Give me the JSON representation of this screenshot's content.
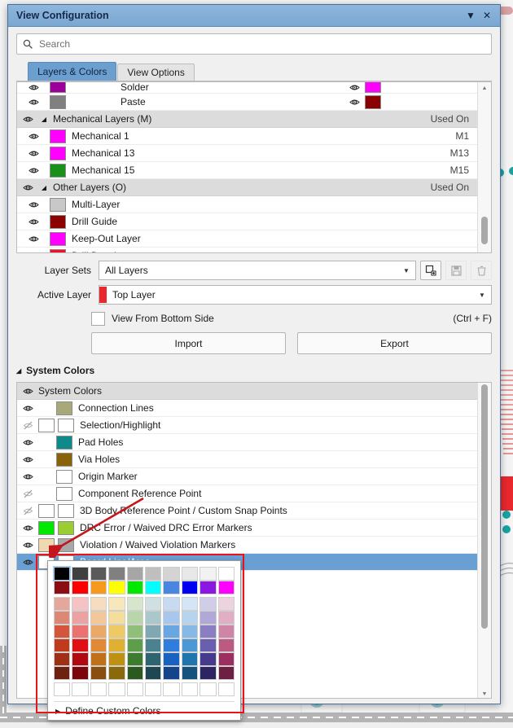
{
  "window": {
    "title": "View Configuration",
    "collapse_icon": "chevron-down-icon",
    "close_icon": "close-icon"
  },
  "search": {
    "placeholder": "Search",
    "value": "",
    "icon": "search-icon"
  },
  "tabs": [
    {
      "label": "Layers & Colors",
      "active": true
    },
    {
      "label": "View Options",
      "active": false
    }
  ],
  "layer_tree": {
    "used_on_header": "Used On",
    "rows": [
      {
        "label": "Solder",
        "used_on": "",
        "color": "#9b009b",
        "color2": "#ff00ff",
        "indent": 1,
        "type": "dual",
        "visible": true,
        "clipped": true
      },
      {
        "label": "Paste",
        "used_on": "",
        "color": "#808080",
        "color2": "#8b0000",
        "indent": 1,
        "type": "dual",
        "visible": true
      },
      {
        "label": "Mechanical Layers (M)",
        "used_on": "Used On",
        "indent": 0,
        "type": "group",
        "visible": true
      },
      {
        "label": "Mechanical 1",
        "used_on": "M1",
        "color": "#ff00ff",
        "indent": 1,
        "type": "layer",
        "visible": true
      },
      {
        "label": "Mechanical 13",
        "used_on": "M13",
        "color": "#ff00ff",
        "indent": 1,
        "type": "layer",
        "visible": true
      },
      {
        "label": "Mechanical 15",
        "used_on": "M15",
        "color": "#1a8f1a",
        "indent": 1,
        "type": "layer",
        "visible": true
      },
      {
        "label": "Other Layers (O)",
        "used_on": "Used On",
        "indent": 0,
        "type": "group",
        "visible": true
      },
      {
        "label": "Multi-Layer",
        "used_on": "",
        "color": "#c8c8c8",
        "indent": 1,
        "type": "layer",
        "visible": true
      },
      {
        "label": "Drill Guide",
        "used_on": "",
        "color": "#8b0000",
        "indent": 1,
        "type": "layer",
        "visible": true
      },
      {
        "label": "Keep-Out Layer",
        "used_on": "",
        "color": "#ff00ff",
        "indent": 1,
        "type": "layer",
        "visible": true
      },
      {
        "label": "Drill Drawing",
        "used_on": "",
        "color": "#f01028",
        "indent": 1,
        "type": "layer",
        "visible": true
      }
    ]
  },
  "controls": {
    "layer_sets_label": "Layer Sets",
    "layer_sets_value": "All Layers",
    "add_layer_set_icon": "add-layer-set-icon",
    "save_layer_set_icon": "save-icon",
    "delete_layer_set_icon": "trash-icon",
    "active_layer_label": "Active Layer",
    "active_layer_value": "Top Layer",
    "active_layer_color": "#e8282d",
    "view_from_bottom_label": "View From Bottom Side",
    "view_from_bottom_checked": false,
    "view_from_bottom_shortcut": "(Ctrl + F)",
    "import_label": "Import",
    "export_label": "Export"
  },
  "system_colors": {
    "section_title": "System Colors",
    "header_label": "System Colors",
    "rows": [
      {
        "label": "Connection Lines",
        "color": "#a8a878",
        "color2": "",
        "visible": true,
        "selected": false
      },
      {
        "label": "Selection/Highlight",
        "color": "#ffffff",
        "color2": "#ffffff",
        "visible": false,
        "selected": false
      },
      {
        "label": "Pad Holes",
        "color": "#0f8a8a",
        "color2": "",
        "visible": true,
        "selected": false
      },
      {
        "label": "Via Holes",
        "color": "#8a6208",
        "color2": "",
        "visible": true,
        "selected": false
      },
      {
        "label": "Origin Marker",
        "color": "#ffffff",
        "color2": "",
        "visible": true,
        "selected": false
      },
      {
        "label": "Component Reference Point",
        "color": "#ffffff",
        "color2": "",
        "visible": false,
        "hidden_eye": true,
        "selected": false
      },
      {
        "label": "3D Body Reference Point / Custom Snap Points",
        "color": "#ffffff",
        "color2": "#ffffff",
        "visible": false,
        "hidden_eye": true,
        "selected": false
      },
      {
        "label": "DRC Error / Waived DRC Error Markers",
        "color": "#00e800",
        "color2": "#9acd32",
        "visible": true,
        "selected": false
      },
      {
        "label": "Violation / Waived Violation Markers",
        "color": "#f0d8b0",
        "color2": "#a8a8a8",
        "visible": true,
        "selected": false
      },
      {
        "label": "Board Line/Area",
        "color": "#ffffff",
        "color2": "#ffffff",
        "visible": true,
        "selected": true
      }
    ]
  },
  "color_picker": {
    "define_custom_label": "Define Custom Colors",
    "define_custom_icon": "triangle-right-icon",
    "selected_index": 0,
    "columns": 10,
    "rows": [
      [
        "#000000",
        "#404040",
        "#5a5a5a",
        "#808080",
        "#a6a6a6",
        "#bfbfbf",
        "#d4d4d4",
        "#e8e8e8",
        "#f2f2f2",
        "#ffffff"
      ],
      [
        "#8b0f12",
        "#ff0000",
        "#f59a1e",
        "#ffff00",
        "#00e800",
        "#00ffff",
        "#4a86e0",
        "#0000f0",
        "#8a18e0",
        "#ff00ff"
      ],
      [
        "#e5a79c",
        "#f5c3c3",
        "#f7ddc0",
        "#f7e8bc",
        "#d5e6cc",
        "#cfdfe2",
        "#c8daf2",
        "#d4e6f5",
        "#cfcde8",
        "#edd3de"
      ],
      [
        "#dd8874",
        "#eca2a2",
        "#f2c79a",
        "#f5dd9d",
        "#b9d6ab",
        "#aac7cc",
        "#a7c8ec",
        "#b7d4ef",
        "#b0a9d8",
        "#e0afc4"
      ],
      [
        "#d4553c",
        "#ec7272",
        "#eaa966",
        "#eec964",
        "#8fbf78",
        "#7fa8b2",
        "#6aa6e2",
        "#86b9e6",
        "#8a7fc2",
        "#cf85a5"
      ],
      [
        "#c03a1d",
        "#e00f16",
        "#e08a38",
        "#e0b033",
        "#5d9e4a",
        "#4b8290",
        "#2f7ede",
        "#4b98d4",
        "#6a5fae",
        "#bd5a82"
      ],
      [
        "#a03015",
        "#b00a10",
        "#bf7018",
        "#bf9112",
        "#3c7c2e",
        "#2d6470",
        "#1a62c0",
        "#2175ad",
        "#463a8c",
        "#9c2f60"
      ],
      [
        "#6d2210",
        "#7c070b",
        "#8a4f10",
        "#8a690c",
        "#2a5a1f",
        "#1d4752",
        "#14458a",
        "#16527c",
        "#2d2463",
        "#6d1f44"
      ],
      [
        "#ffffff",
        "#ffffff",
        "#ffffff",
        "#ffffff",
        "#ffffff",
        "#ffffff",
        "#ffffff",
        "#ffffff",
        "#ffffff",
        "#ffffff"
      ]
    ]
  }
}
